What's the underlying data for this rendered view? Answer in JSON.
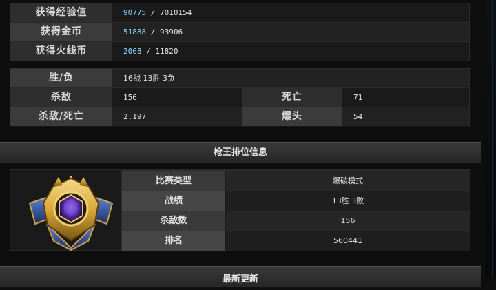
{
  "rewards": {
    "rows": [
      {
        "label": "获得经验值",
        "value": "90775",
        "total": " / 7010154"
      },
      {
        "label": "获得金币",
        "value": "51888",
        "total": " / 93906"
      },
      {
        "label": "获得火线币",
        "value": "2068",
        "total": " / 11820"
      }
    ]
  },
  "stats": {
    "win_loss_label": "胜/负",
    "win_loss_value": "16战 13胜 3负",
    "kills_label": "杀敌",
    "kills_value": "156",
    "deaths_label": "死亡",
    "deaths_value": "71",
    "kd_label": "杀敌/死亡",
    "kd_value": "2.197",
    "headshot_label": "爆头",
    "headshot_value": "54"
  },
  "ranked": {
    "section_title": "枪王排位信息",
    "rows": [
      {
        "label": "比赛类型",
        "value": "爆破模式"
      },
      {
        "label": "战绩",
        "value": "13胜 3败"
      },
      {
        "label": "杀敌数",
        "value": "156"
      },
      {
        "label": "排名",
        "value": "560441"
      }
    ]
  },
  "updates": {
    "section_title": "最新更新"
  },
  "colors": {
    "highlight_value": "#8fd6ff",
    "badge_gold": "#d8a93a",
    "badge_gem": "#5b2fb0"
  }
}
